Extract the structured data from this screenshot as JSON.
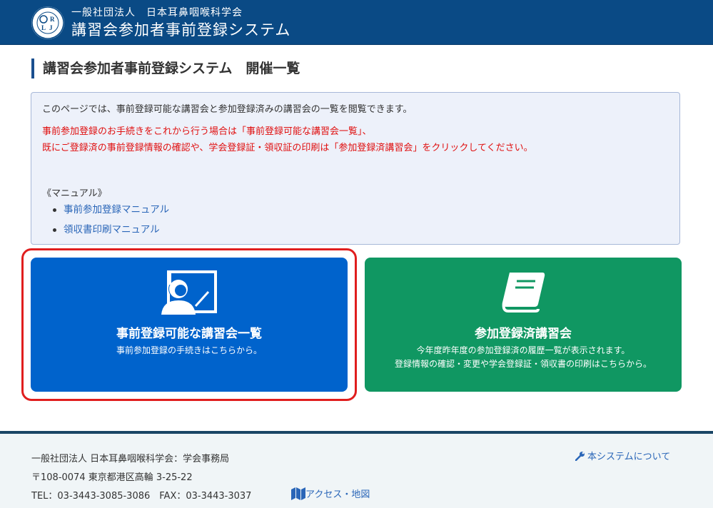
{
  "header": {
    "org": "一般社団法人　日本耳鼻咽喉科学会",
    "title": "講習会参加者事前登録システム",
    "logo_letters": "ORLJ"
  },
  "page": {
    "title": "講習会参加者事前登録システム　開催一覧"
  },
  "info": {
    "line1": "このページでは、事前登録可能な講習会と参加登録済みの講習会の一覧を閲覧できます。",
    "line2": "事前参加登録のお手続きをこれから行う場合は「事前登録可能な講習会一覧」、",
    "line3": "既にご登録済の事前登録情報の確認や、学会登録証・領収証の印刷は「参加登録済講習会」をクリックしてください。",
    "manual_label": "《マニュアル》",
    "manuals": [
      {
        "label": "事前参加登録マニュアル"
      },
      {
        "label": "領収書印刷マニュアル"
      }
    ]
  },
  "cards": {
    "available": {
      "title": "事前登録可能な講習会一覧",
      "subtitle": "事前参加登録の手続きはこちらから。",
      "color": "#0063cc"
    },
    "registered": {
      "title": "参加登録済講習会",
      "subtitle1": "今年度昨年度の参加登録済の履歴一覧が表示されます。",
      "subtitle2": "登録情報の確認・変更や学会登録証・領収書の印刷はこちらから。",
      "color": "#109762"
    }
  },
  "footer": {
    "org": "一般社団法人 日本耳鼻咽喉科学会：学会事務局",
    "address": "〒108-0074 東京都港区高輪 3-25-22",
    "contact": "TEL：03-3443-3085-3086　FAX：03-3443-3037",
    "access_label": "アクセス・地図",
    "about_label": "本システムについて"
  },
  "colors": {
    "header_bg": "#0a4a85",
    "highlight": "#e01e1e",
    "notice_red": "#e01010",
    "link": "#2a66b8"
  }
}
